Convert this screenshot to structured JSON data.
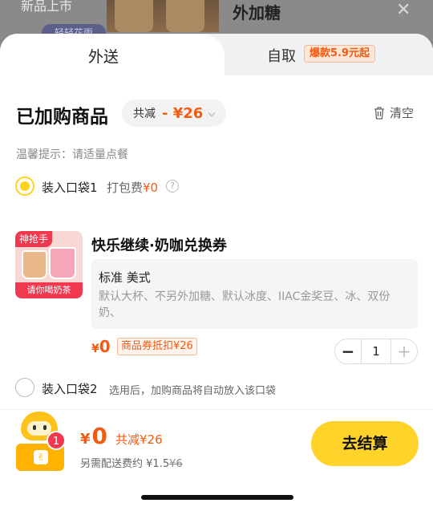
{
  "background": {
    "left_text": "新品上市",
    "tag": "轻轻花雨",
    "title": "外加糖",
    "close_icon": "close-icon"
  },
  "tabs": {
    "delivery": "外送",
    "pickup": "自取",
    "pickup_badge": "爆款5.9元起"
  },
  "cart": {
    "title": "已加购商品",
    "discount_label": "共减",
    "discount_amount": "- ¥26",
    "clear_label": "清空",
    "tip": "温馨提示：请适量点餐"
  },
  "bag1": {
    "label": "装入口袋1",
    "fee_label": "打包费",
    "fee": "¥0"
  },
  "product": {
    "flag": "神抢手",
    "caption": "请你喝奶茶",
    "name": "快乐继续·奶咖兑换券",
    "spec_title": "标准 美式",
    "spec_desc": "默认大杯、不另外加糖、默认冰度、IIAC金奖豆、冰、双份奶、",
    "price_symbol": "¥",
    "price": "0",
    "coupon_tag": "商品券抵扣¥26",
    "quantity": "1"
  },
  "bag2": {
    "label": "装入口袋2",
    "hint": "选用后，加购商品将自动放入该口袋"
  },
  "footer": {
    "badge_count": "1",
    "total_symbol": "¥",
    "total": "0",
    "total_discount": "共减¥26",
    "fee_prefix": "另需配送费约",
    "fee_now": "¥1.5",
    "fee_orig": "¥6",
    "checkout_label": "去结算"
  },
  "colors": {
    "accent_orange": "#f25b12",
    "brand_yellow": "#ffd32a",
    "badge_red": "#f0384f"
  }
}
